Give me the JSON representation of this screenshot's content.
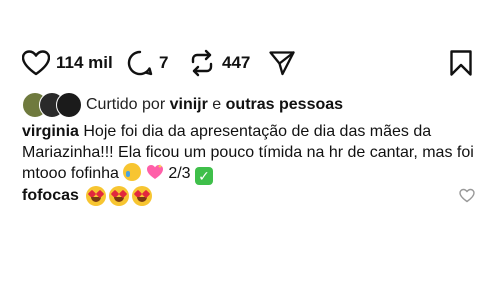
{
  "actions": {
    "likes": "114 mil",
    "comments": "7",
    "reposts": "447"
  },
  "liked_by": {
    "prefix": "Curtido por",
    "user": "vinijr",
    "connector": "e",
    "others": "outras pessoas"
  },
  "caption": {
    "username": "virginia",
    "text": "Hoje foi dia da apresentação de dia das mães da Mariazinha!!! Ela ficou um pouco tímida na hr de cantar, mas foi mtooo fofinha",
    "suffix": "2/3"
  },
  "comment": {
    "username": "fofocas"
  },
  "icons": {
    "like": "heart-icon",
    "comment": "comment-bubble-icon",
    "repost": "repost-icon",
    "share": "send-icon",
    "save": "bookmark-icon"
  }
}
